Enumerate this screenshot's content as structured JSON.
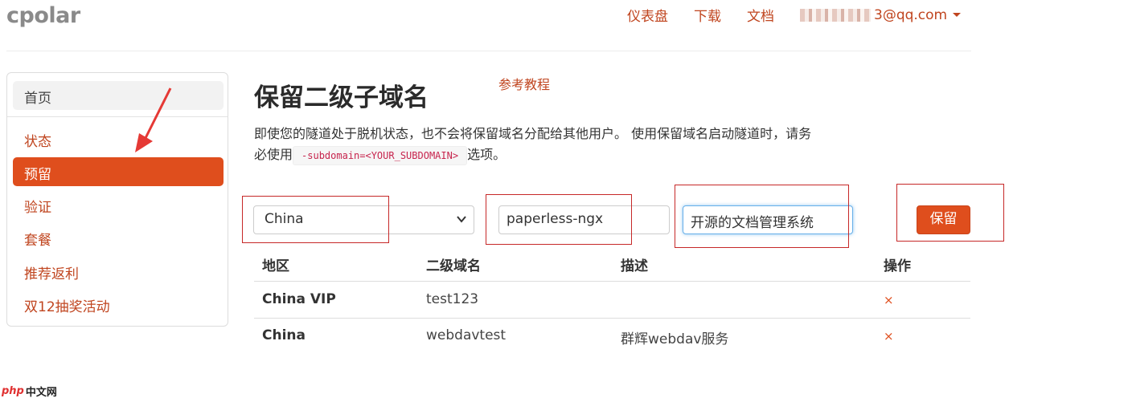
{
  "brand": {
    "logo": "cpolar"
  },
  "topnav": {
    "items": [
      {
        "label": "仪表盘"
      },
      {
        "label": "下载"
      },
      {
        "label": "文档"
      }
    ],
    "user_email_suffix": "3@qq.com"
  },
  "sidebar": {
    "home": "首页",
    "items": [
      {
        "label": "状态"
      },
      {
        "label": "预留",
        "active": true
      },
      {
        "label": "验证"
      },
      {
        "label": "套餐"
      },
      {
        "label": "推荐返利"
      },
      {
        "label": "双12抽奖活动"
      }
    ]
  },
  "main": {
    "title": "保留二级子域名",
    "tutorial_link": "参考教程",
    "description_part1": "即使您的隧道处于脱机状态，也不会将保留域名分配给其他用户。 使用保留域名启动隧道时，请务必使用",
    "code_snippet": "-subdomain=<YOUR_SUBDOMAIN>",
    "description_part2": "选项。"
  },
  "form": {
    "region_selected": "China",
    "subdomain_value": "paperless-ngx",
    "description_value": "开源的文档管理系统",
    "save_label": "保留"
  },
  "table": {
    "headers": [
      "地区",
      "二级域名",
      "描述",
      "操作"
    ],
    "rows": [
      {
        "region": "China VIP",
        "subdomain": "test123",
        "description": "",
        "action": "×"
      },
      {
        "region": "China",
        "subdomain": "webdavtest",
        "description": "群辉webdav服务",
        "action": "×"
      }
    ]
  },
  "watermark": {
    "php": "php",
    "cn": "中文网"
  },
  "colors": {
    "accent": "#df4e1d",
    "link": "#c0451f",
    "annotation": "#c62828"
  }
}
